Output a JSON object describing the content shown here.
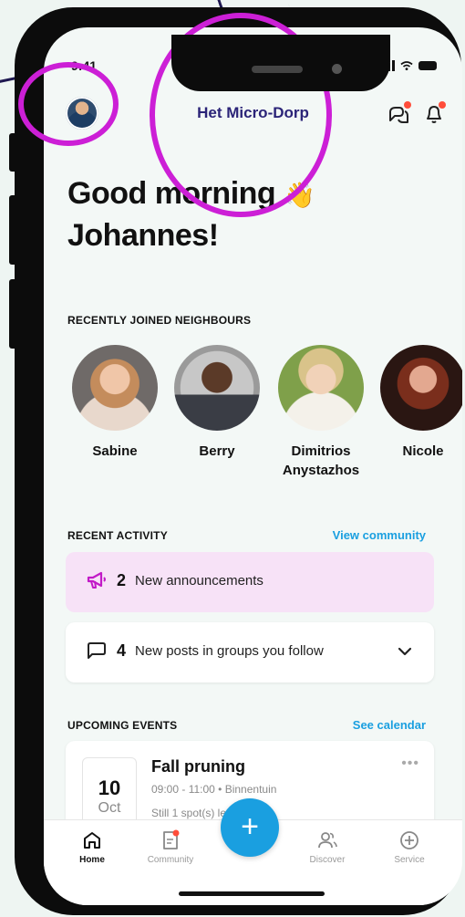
{
  "status_bar": {
    "time": "9:41"
  },
  "header": {
    "community_name": "Het Micro-Dorp"
  },
  "greeting": {
    "line1": "Good morning",
    "emoji": "👋",
    "line2": "Johannes!"
  },
  "neighbours_section": {
    "label": "RECENTLY JOINED NEIGHBOURS",
    "items": [
      {
        "name": "Sabine"
      },
      {
        "name": "Berry"
      },
      {
        "name": "Dimitrios Anystazhos"
      },
      {
        "name": "Nicole"
      }
    ]
  },
  "activity_section": {
    "label": "RECENT ACTIVITY",
    "link": "View community",
    "announcements": {
      "count": "2",
      "text": "New announcements"
    },
    "posts": {
      "count": "4",
      "text": "New posts in groups you follow"
    }
  },
  "events_section": {
    "label": "UPCOMING EVENTS",
    "link": "See calendar",
    "event": {
      "day": "10",
      "month": "Oct",
      "title": "Fall pruning",
      "time": "09:00 - 11:00 • Binnentuin",
      "spots": "Still 1 spot(s) left"
    }
  },
  "tab_bar": {
    "home": "Home",
    "community": "Community",
    "add": "+",
    "discover": "Discover",
    "service": "Service"
  },
  "colors": {
    "accent": "#1a9fe0",
    "title": "#2b2478",
    "announce_bg": "#f7e2f7",
    "announce_icon": "#c21ac7",
    "annotation": "#cc1fd6",
    "notification_dot": "#ff4d3a"
  }
}
